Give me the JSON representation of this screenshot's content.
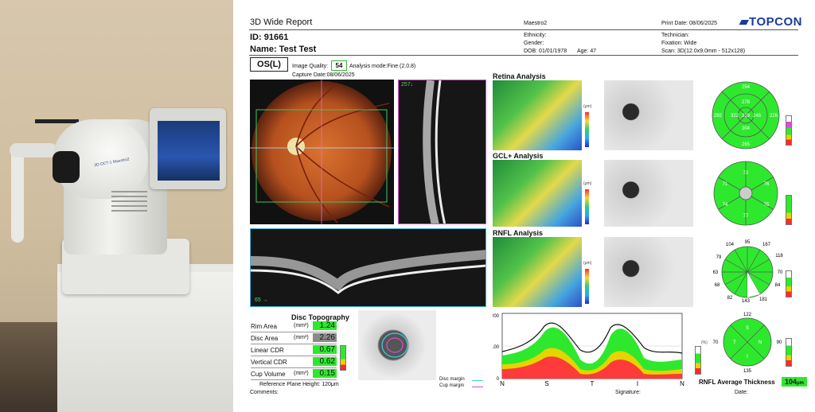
{
  "report": {
    "title": "3D Wide Report",
    "device": "Maestro2",
    "print_date": "Print Date: 08/06/2025",
    "brand": "TOPCON",
    "patient_id": "ID: 91661",
    "patient_name": "Name: Test Test",
    "ethnicity": "Ethnicity:",
    "gender": "Gender:",
    "dob": "DOB: 01/01/1978",
    "age": "Age: 47",
    "technician": "Technician:",
    "fixation": "Fixation: Wide",
    "scan": "Scan: 3D(12.0x9.0mm - 512x128)",
    "eye": "OS(L)",
    "image_quality_label": "Image Quality:",
    "image_quality": "54",
    "analysis_mode": "Analysis mode:Fine (2.0.8)",
    "capture_date": "Capture Date:08/06/2025",
    "oct_v_label": "257↓",
    "oct_h_label": "65 →"
  },
  "analyses": {
    "retina": "Retina Analysis",
    "gcl": "GCL+ Analysis",
    "rnfl": "RNFL Analysis",
    "unit": "(μm)",
    "scale_ticks": [
      "500",
      "400",
      "300",
      "200",
      "100",
      "0"
    ],
    "gcl_ticks": [
      "300",
      "200",
      "100",
      "0"
    ]
  },
  "retina_grid": {
    "values": [
      "254",
      "278",
      "322",
      "292",
      "319",
      "246",
      "304",
      "265",
      "226",
      "264",
      "276"
    ]
  },
  "gcl_grid": {
    "values": [
      "72",
      "76",
      "75",
      "77",
      "74",
      "71"
    ]
  },
  "rnfl_clock": {
    "values": [
      "95",
      "167",
      "118",
      "70",
      "84",
      "181",
      "143",
      "82",
      "68",
      "63",
      "79",
      "104"
    ]
  },
  "rnfl_quadrant": {
    "values": [
      "122",
      "90",
      "135",
      "70"
    ],
    "letters": [
      "S",
      "N",
      "I",
      "T"
    ]
  },
  "legend_pct": {
    "unit": "(%)",
    "ticks": [
      "95",
      "5",
      "1"
    ]
  },
  "disc_topography": {
    "title": "Disc Topography",
    "rows": [
      {
        "label": "Rim Area",
        "unit": "(mm²)",
        "value": "1.24",
        "color": "#2ee82e"
      },
      {
        "label": "Disc Area",
        "unit": "(mm²)",
        "value": "2.26",
        "color": "#8a8a8a"
      },
      {
        "label": "Linear CDR",
        "unit": "",
        "value": "0.67",
        "color": "#2ee82e"
      },
      {
        "label": "Vertical CDR",
        "unit": "",
        "value": "0.62",
        "color": "#2ee82e"
      },
      {
        "label": "Cup Volume",
        "unit": "(mm³)",
        "value": "0.15",
        "color": "#2ee82e"
      }
    ],
    "reference_plane": "Reference Plane Height: 120μm",
    "disc_margin": "Disc margin",
    "cup_margin": "Cup margin"
  },
  "tsnit": {
    "y_ticks": [
      "200",
      "100",
      "0"
    ],
    "x_labels": [
      "N",
      "S",
      "T",
      "I",
      "N"
    ],
    "legend_unit": "(%)",
    "legend_ticks": [
      "95",
      "5",
      "1"
    ]
  },
  "rnfl_average": {
    "label": "RNFL Average Thickness",
    "value": "104",
    "unit": "μm"
  },
  "footer": {
    "comments": "Comments:",
    "signature": "Signature:",
    "date": "Date:"
  },
  "photo": {
    "screen_brand": "TOPCON",
    "model_label": "3D OCT-1 Maestro2"
  },
  "colors": {
    "normal": "#2ee82e",
    "border": "#e4d400",
    "abnormal": "#ff2a2a",
    "accent_fundus_box": "#38b05a"
  }
}
